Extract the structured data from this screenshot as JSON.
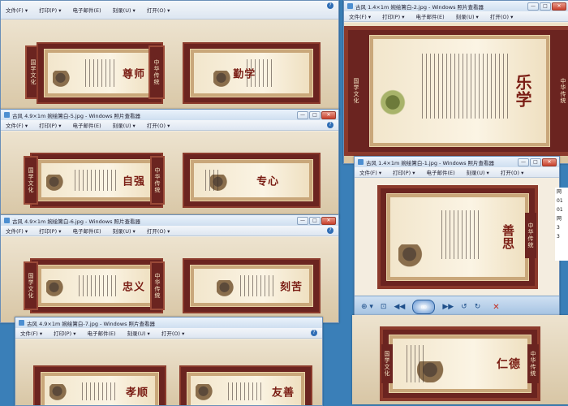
{
  "menu": {
    "file": "文件(F) ▾",
    "print": "打印(P) ▾",
    "email": "电子邮件(E)",
    "burn": "刻录(U) ▾",
    "open": "打开(O) ▾",
    "help": "?"
  },
  "win_controls": {
    "min": "—",
    "max": "□",
    "close": "✕"
  },
  "windows": [
    {
      "title": "",
      "tag": "w0"
    },
    {
      "title": "古风 1.4×1m 婉绘篱白-2.jpg - Windows 照片查看器",
      "tag": "w-2"
    },
    {
      "title": "古风 4.9×1m 婉绘篱白-5.jpg - Windows 照片查看器",
      "tag": "w-5"
    },
    {
      "title": "古风 4.9×1m 婉绘篱白-6.jpg - Windows 照片查看器",
      "tag": "w-6"
    },
    {
      "title": "古风 4.9×1m 婉绘篱白-7.jpg - Windows 照片查看器",
      "tag": "w-7"
    },
    {
      "title": "古风 1.4×1m 婉绘篱白-1.jpg - Windows 照片查看器",
      "tag": "w-1"
    }
  ],
  "boards": {
    "shishi": "尊师",
    "qinxue": "勤学",
    "ziqiang": "自强",
    "zhuanxin": "专心",
    "zhongyi": "忠义",
    "kechuang": "刻苦",
    "xiaoshun": "孝顺",
    "youshan": "友善",
    "lexue": "乐学",
    "xiangsi": "善思",
    "rende": "仁德"
  },
  "side_labels": {
    "guoxue": "国学文化",
    "chuantong": "中华传统"
  },
  "partial_text": {
    "jian": "件"
  },
  "right_strip": [
    "网",
    "01",
    "01",
    "网",
    "3",
    "3"
  ],
  "toolbar": {
    "zoom": "⊕ ▾",
    "fit": "⊡",
    "prev": "◀◀",
    "play": "▭",
    "next": "▶▶",
    "rotl": "↺",
    "rotr": "↻",
    "del": "✕"
  }
}
